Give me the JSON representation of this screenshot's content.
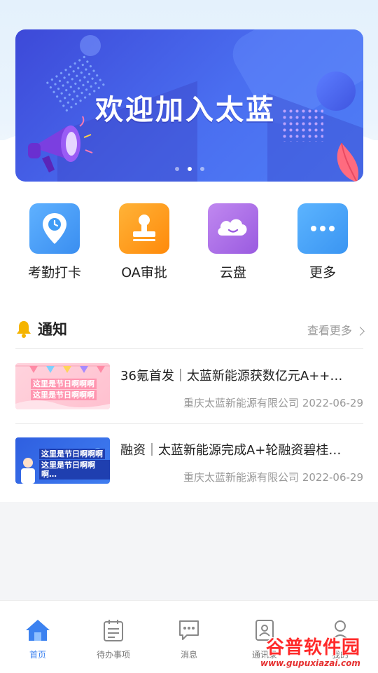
{
  "banner": {
    "title": "欢迎加入太蓝",
    "pager_count": 3,
    "pager_active": 2
  },
  "quick_actions": [
    {
      "label": "考勤打卡",
      "icon": "location-clock-icon",
      "color": "#3f9cf5"
    },
    {
      "label": "OA审批",
      "icon": "stamp-icon",
      "color": "#ff9b1a"
    },
    {
      "label": "云盘",
      "icon": "cloud-icon",
      "color": "#a56ae0"
    },
    {
      "label": "更多",
      "icon": "more-dots-icon",
      "color": "#44a5f5"
    }
  ],
  "notice": {
    "title": "通知",
    "more": "查看更多"
  },
  "news": [
    {
      "title": "36氪首发｜太蓝新能源获数亿元A++…",
      "source": "重庆太蓝新能源有限公司",
      "date": "2022-06-29",
      "thumb_lines": [
        "这里是节日啊啊啊",
        "这里是节日啊啊啊"
      ]
    },
    {
      "title": "融资｜太蓝新能源完成A+轮融资碧桂…",
      "source": "重庆太蓝新能源有限公司",
      "date": "2022-06-29",
      "thumb_lines": [
        "这里是节日啊啊啊",
        "这里是节日啊啊啊…"
      ]
    }
  ],
  "tabs": [
    {
      "label": "首页",
      "icon": "home-icon",
      "active": true
    },
    {
      "label": "待办事项",
      "icon": "todo-icon",
      "active": false
    },
    {
      "label": "消息",
      "icon": "message-icon",
      "active": false
    },
    {
      "label": "通讯录",
      "icon": "contacts-icon",
      "active": false
    },
    {
      "label": "我的",
      "icon": "profile-icon",
      "active": false
    }
  ],
  "watermark": {
    "main": "谷普软件园",
    "sub": "www.gupuxiazai.com"
  },
  "colors": {
    "accent": "#3c82f0",
    "banner": "#4a6ef0",
    "bell": "#f5b400"
  }
}
